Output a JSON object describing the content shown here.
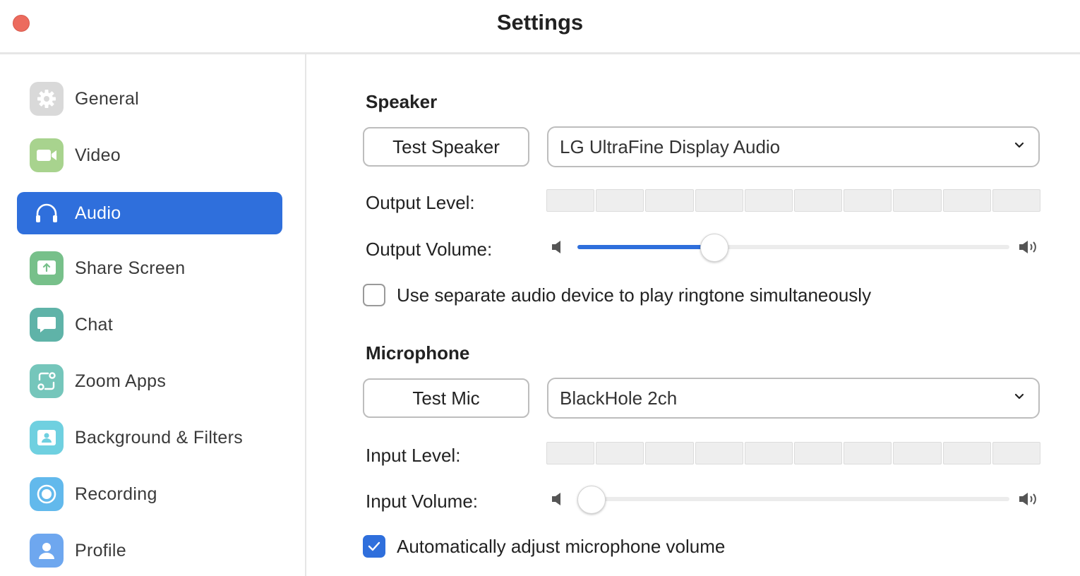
{
  "window": {
    "title": "Settings"
  },
  "sidebar": {
    "items": [
      {
        "label": "General",
        "icon": "gear-icon",
        "color": "#d9d9d9",
        "active": false
      },
      {
        "label": "Video",
        "icon": "video-camera-icon",
        "color": "#a8d38e",
        "active": false
      },
      {
        "label": "Audio",
        "icon": "headphones-icon",
        "color": "#2f6fdc",
        "active": true
      },
      {
        "label": "Share Screen",
        "icon": "share-screen-icon",
        "color": "#77c08a",
        "active": false
      },
      {
        "label": "Chat",
        "icon": "chat-bubble-icon",
        "color": "#5fb3a8",
        "active": false
      },
      {
        "label": "Zoom Apps",
        "icon": "zoom-apps-icon",
        "color": "#75c6bb",
        "active": false
      },
      {
        "label": "Background & Filters",
        "icon": "background-filters-icon",
        "color": "#6fd0e0",
        "active": false
      },
      {
        "label": "Recording",
        "icon": "recording-icon",
        "color": "#62b9ec",
        "active": false
      },
      {
        "label": "Profile",
        "icon": "profile-icon",
        "color": "#6ea7ef",
        "active": false
      }
    ]
  },
  "speaker": {
    "section_title": "Speaker",
    "test_button": "Test Speaker",
    "device": "LG UltraFine Display Audio",
    "output_level_label": "Output Level:",
    "output_volume_label": "Output Volume:",
    "output_volume_fraction": 0.315,
    "separate_device_label": "Use separate audio device to play ringtone simultaneously",
    "separate_device_checked": false
  },
  "microphone": {
    "section_title": "Microphone",
    "test_button": "Test Mic",
    "device": "BlackHole 2ch",
    "input_level_label": "Input Level:",
    "input_volume_label": "Input Volume:",
    "input_volume_fraction": 0.0,
    "auto_adjust_label": "Automatically adjust microphone volume",
    "auto_adjust_checked": true
  },
  "colors": {
    "accent": "#2f6fdc",
    "close_button": "#ec6b5e"
  }
}
